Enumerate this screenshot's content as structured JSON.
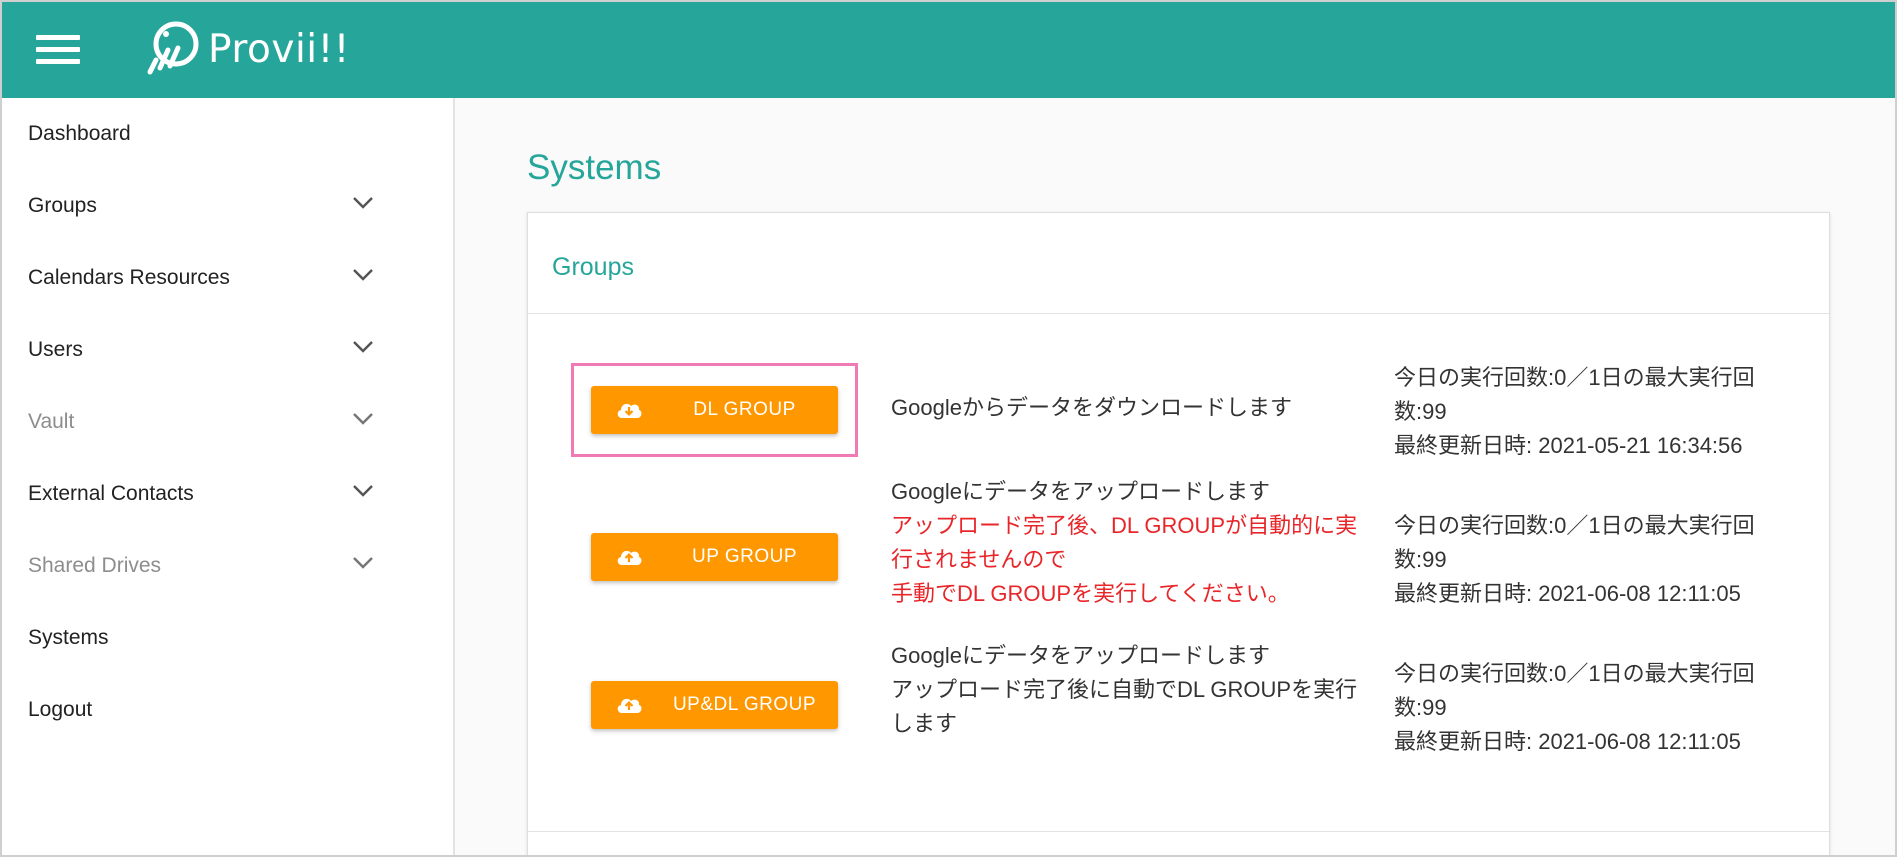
{
  "header": {
    "brand": "Provii!!",
    "bg_color": "#26a69a"
  },
  "sidebar": {
    "items": [
      {
        "label": "Dashboard",
        "expandable": false,
        "enabled": true
      },
      {
        "label": "Groups",
        "expandable": true,
        "enabled": true
      },
      {
        "label": "Calendars Resources",
        "expandable": true,
        "enabled": true
      },
      {
        "label": "Users",
        "expandable": true,
        "enabled": true
      },
      {
        "label": "Vault",
        "expandable": true,
        "enabled": false
      },
      {
        "label": "External Contacts",
        "expandable": true,
        "enabled": true
      },
      {
        "label": "Shared Drives",
        "expandable": true,
        "enabled": false
      },
      {
        "label": "Systems",
        "expandable": false,
        "enabled": true
      },
      {
        "label": "Logout",
        "expandable": false,
        "enabled": true
      }
    ]
  },
  "main": {
    "title": "Systems",
    "card": {
      "title": "Groups",
      "rows": [
        {
          "button_label": "DL GROUP",
          "button_icon": "cloud-download-icon",
          "highlighted": true,
          "desc": [
            "Googleからデータをダウンロードします"
          ],
          "desc_red": [],
          "stats": [
            "今日の実行回数:0／1日の最大実行回",
            "数:99",
            "最終更新日時: 2021-05-21 16:34:56"
          ]
        },
        {
          "button_label": "UP GROUP",
          "button_icon": "cloud-upload-icon",
          "highlighted": false,
          "desc": [
            "Googleにデータをアップロードします"
          ],
          "desc_red": [
            "アップロード完了後、DL GROUPが自動的に実",
            "行されませんので",
            "手動でDL GROUPを実行してください。"
          ],
          "stats": [
            "今日の実行回数:0／1日の最大実行回",
            "数:99",
            "最終更新日時: 2021-06-08 12:11:05"
          ]
        },
        {
          "button_label": "UP&DL GROUP",
          "button_icon": "cloud-upload-icon",
          "highlighted": false,
          "desc": [
            "Googleにデータをアップロードします",
            "アップロード完了後に自動でDL GROUPを実行",
            "します"
          ],
          "desc_red": [],
          "stats": [
            "今日の実行回数:0／1日の最大実行回",
            "数:99",
            "最終更新日時: 2021-06-08 12:11:05"
          ]
        }
      ]
    }
  },
  "colors": {
    "accent": "#26a69a",
    "button": "#ff9800",
    "highlight_border": "#f07ab4",
    "warning_text": "#e8262a"
  }
}
